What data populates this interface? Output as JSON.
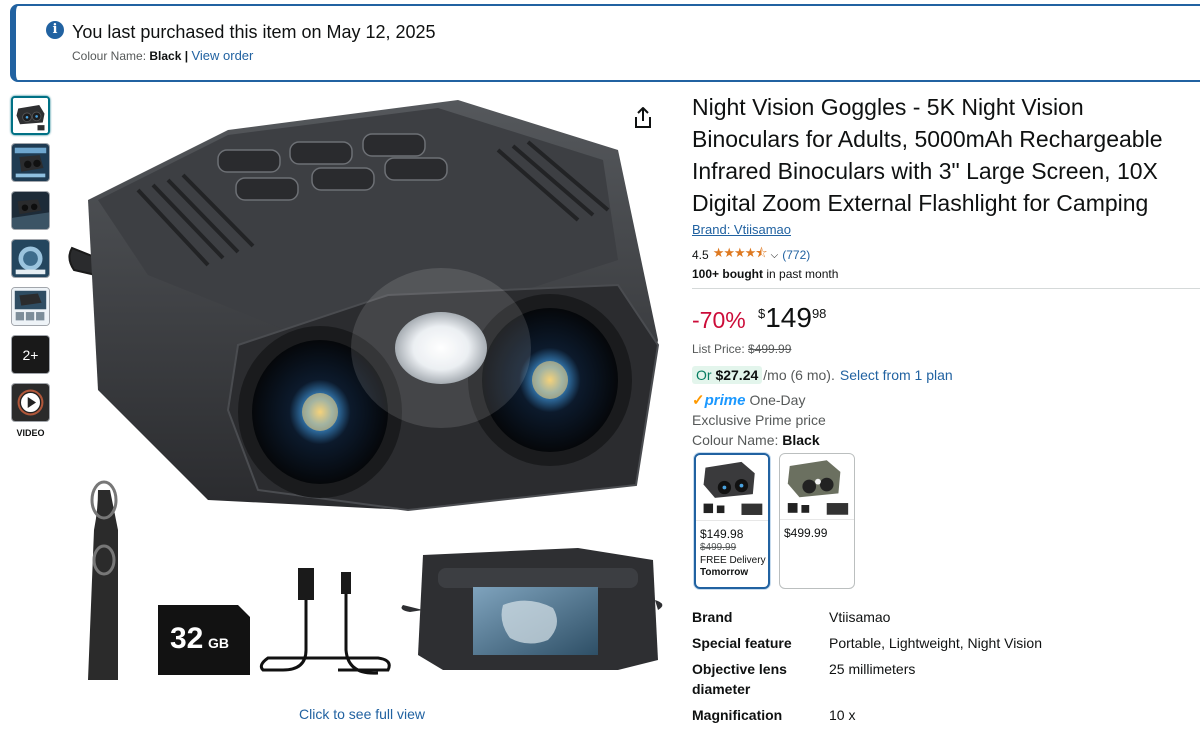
{
  "banner": {
    "title": "You last purchased this item on May 12, 2025",
    "colour_label": "Colour Name:",
    "colour_value": "Black",
    "separator": "|",
    "view_order": "View order"
  },
  "gallery": {
    "more_count": "2+",
    "video_label": "VIDEO",
    "full_view_link": "Click to see full view",
    "storage_label_big": "32",
    "storage_label_small": "GB"
  },
  "product": {
    "title": "Night Vision Goggles - 5K Night Vision Binoculars for Adults, 5000mAh Rechargeable Infrared Binoculars with 3\" Large Screen, 10X Digital Zoom External Flashlight for Camping",
    "brand_link": "Brand: Vtiisamao",
    "rating": "4.5",
    "stars_glyph": "★★★★⯪",
    "rating_fraction": 0.9,
    "chevron": "⌵",
    "review_count": "(772)",
    "bought_bold": "100+ bought",
    "bought_rest": " in past month"
  },
  "pricing": {
    "discount": "-70%",
    "currency": "$",
    "whole": "149",
    "fraction": "98",
    "list_price_label": "List Price: ",
    "list_price": "$499.99",
    "installment_or": "Or ",
    "installment_amount": "$27.24",
    "installment_rest": "/mo (6 mo).",
    "installment_link": "Select from 1 plan",
    "prime_check": "✓",
    "prime_word": "prime",
    "prime_speed": "One-Day",
    "exclusive": "Exclusive Prime price",
    "colour_label": "Colour Name: ",
    "colour_value": "Black"
  },
  "swatches": [
    {
      "price": "$149.98",
      "old_price": "$499.99",
      "delivery": "FREE Delivery",
      "delivery_day": "Tomorrow",
      "body_color": "#3a3a3c"
    },
    {
      "price": "$499.99",
      "body_color": "#6b7060"
    }
  ],
  "specs": [
    {
      "key": "Brand",
      "value": "Vtiisamao"
    },
    {
      "key": "Special feature",
      "value": "Portable, Lightweight, Night Vision"
    },
    {
      "key": "Objective lens diameter",
      "value": "25 millimeters"
    },
    {
      "key": "Magnification",
      "value": "10 x"
    }
  ],
  "colors": {
    "link": "#2162a1",
    "discount": "#cc0c39",
    "star": "#de7921",
    "prime": "#1a98ff",
    "selected_border": "#2162a1"
  }
}
